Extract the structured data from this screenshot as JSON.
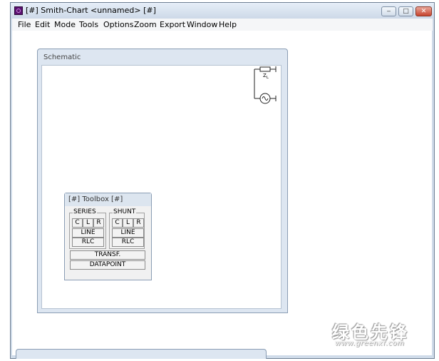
{
  "window": {
    "title": "[#] Smith-Chart <unnamed> [#]",
    "controls": {
      "minimize": "‒",
      "maximize": "□",
      "close": "✕"
    }
  },
  "menu": [
    "File",
    "Edit",
    "Mode",
    "Tools",
    "Options",
    "Zoom",
    "Export",
    "Window",
    "Help"
  ],
  "schematic": {
    "title": "Schematic",
    "load_label": "Z",
    "load_subscript": "L"
  },
  "toolbox": {
    "title": "[#] Toolbox [#]",
    "series": {
      "label": "SERIES",
      "c": "C",
      "l": "L",
      "r": "R",
      "line": "LINE",
      "rlc": "RLC"
    },
    "shunt": {
      "label": "SHUNT",
      "c": "C",
      "l": "L",
      "r": "R",
      "line": "LINE",
      "rlc": "RLC"
    },
    "transf": "TRANSF.",
    "datapoint": "DATAPOINT"
  },
  "watermark": {
    "brand": "绿色先锋",
    "url": "www.greenxf.com"
  },
  "colors": {
    "frame": "#cfdbe9",
    "child_frame": "#dde6f1",
    "app_icon": "#5a1070"
  }
}
